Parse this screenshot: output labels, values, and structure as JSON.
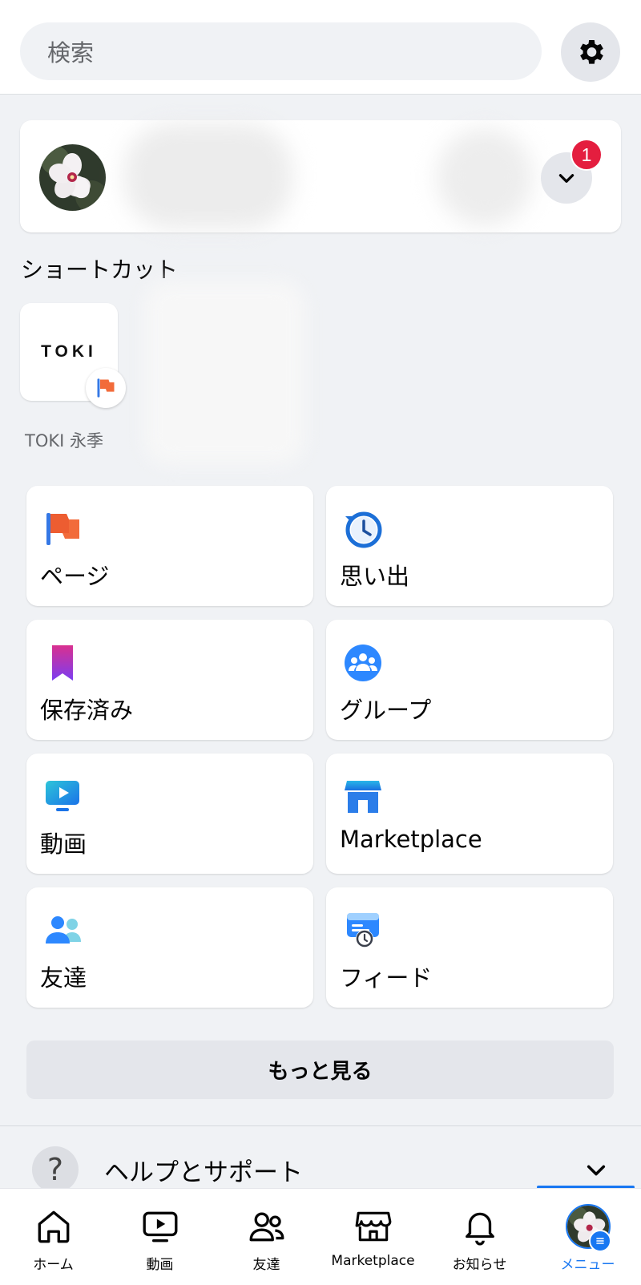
{
  "search": {
    "placeholder": "検索"
  },
  "settings": {
    "icon": "gear-icon"
  },
  "profile": {
    "notification_count": "1"
  },
  "shortcuts": {
    "title": "ショートカット",
    "items": [
      {
        "logo_text": "TOKI",
        "label": "TOKI 永季"
      }
    ]
  },
  "menu": {
    "items": [
      {
        "label": "ページ",
        "icon": "flag-icon"
      },
      {
        "label": "思い出",
        "icon": "memories-clock-icon"
      },
      {
        "label": "保存済み",
        "icon": "bookmark-icon"
      },
      {
        "label": "グループ",
        "icon": "groups-icon"
      },
      {
        "label": "動画",
        "icon": "video-icon"
      },
      {
        "label": "Marketplace",
        "icon": "marketplace-icon"
      },
      {
        "label": "友達",
        "icon": "friends-icon"
      },
      {
        "label": "フィード",
        "icon": "feed-icon"
      }
    ],
    "more_label": "もっと見る"
  },
  "help": {
    "label": "ヘルプとサポート",
    "icon": "question-icon",
    "help_symbol": "?"
  },
  "bottom_nav": {
    "items": [
      {
        "label": "ホーム",
        "icon": "home-icon"
      },
      {
        "label": "動画",
        "icon": "video-icon"
      },
      {
        "label": "友達",
        "icon": "friends-icon"
      },
      {
        "label": "Marketplace",
        "icon": "marketplace-icon"
      },
      {
        "label": "お知らせ",
        "icon": "bell-icon"
      },
      {
        "label": "メニュー",
        "icon": "avatar-menu-icon",
        "active": true
      }
    ]
  },
  "colors": {
    "accent": "#1877f2",
    "badge": "#e41e3f",
    "background": "#f0f2f5"
  }
}
